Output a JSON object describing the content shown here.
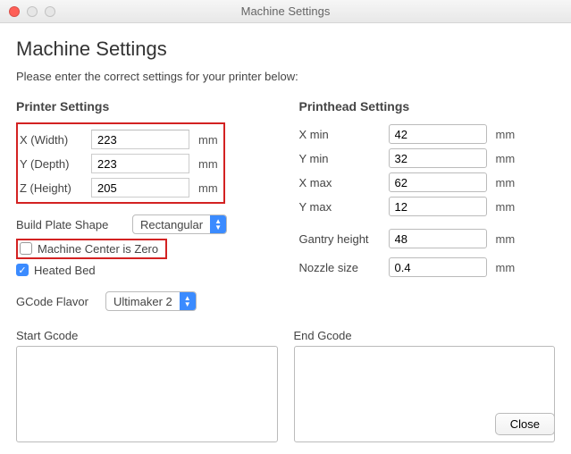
{
  "window": {
    "title": "Machine Settings"
  },
  "heading": "Machine Settings",
  "intro": "Please enter the correct settings for your printer below:",
  "printer": {
    "title": "Printer Settings",
    "x_label": "X (Width)",
    "x_value": "223",
    "y_label": "Y (Depth)",
    "y_value": "223",
    "z_label": "Z (Height)",
    "z_value": "205",
    "unit": "mm",
    "build_plate_label": "Build Plate Shape",
    "build_plate_value": "Rectangular",
    "center_zero_label": "Machine Center is Zero",
    "center_zero_checked": false,
    "heated_bed_label": "Heated Bed",
    "heated_bed_checked": true,
    "gcode_flavor_label": "GCode Flavor",
    "gcode_flavor_value": "Ultimaker 2"
  },
  "printhead": {
    "title": "Printhead Settings",
    "xmin_label": "X min",
    "xmin_value": "42",
    "ymin_label": "Y min",
    "ymin_value": "32",
    "xmax_label": "X max",
    "xmax_value": "62",
    "ymax_label": "Y max",
    "ymax_value": "12",
    "gantry_label": "Gantry height",
    "gantry_value": "48",
    "nozzle_label": "Nozzle size",
    "nozzle_value": "0.4",
    "unit": "mm"
  },
  "start_gcode_label": "Start Gcode",
  "end_gcode_label": "End Gcode",
  "start_gcode_value": "",
  "end_gcode_value": "",
  "close_label": "Close"
}
